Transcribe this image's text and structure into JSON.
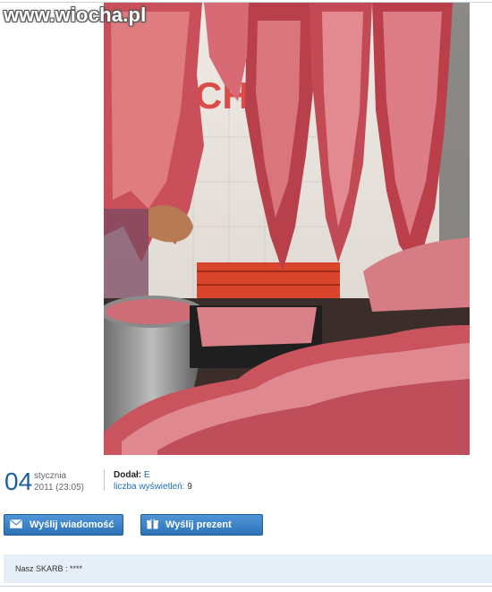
{
  "site": {
    "watermark": "www.wiocha.pl"
  },
  "post": {
    "date": {
      "day": "04",
      "month": "stycznia",
      "year_time": "2011 (23:05)"
    },
    "added_label": "Dodał:",
    "added_user": "E",
    "views_label": "liczba wyświetleń:",
    "views_count": "9"
  },
  "actions": {
    "send_message": "Wyślij wiadomość",
    "send_gift": "Wyślij prezent"
  },
  "comment": {
    "text": "Nasz SKARB : ****"
  },
  "colors": {
    "accent": "#1b5fa3",
    "button": "#3a80c4",
    "panel": "#e6eef8"
  }
}
